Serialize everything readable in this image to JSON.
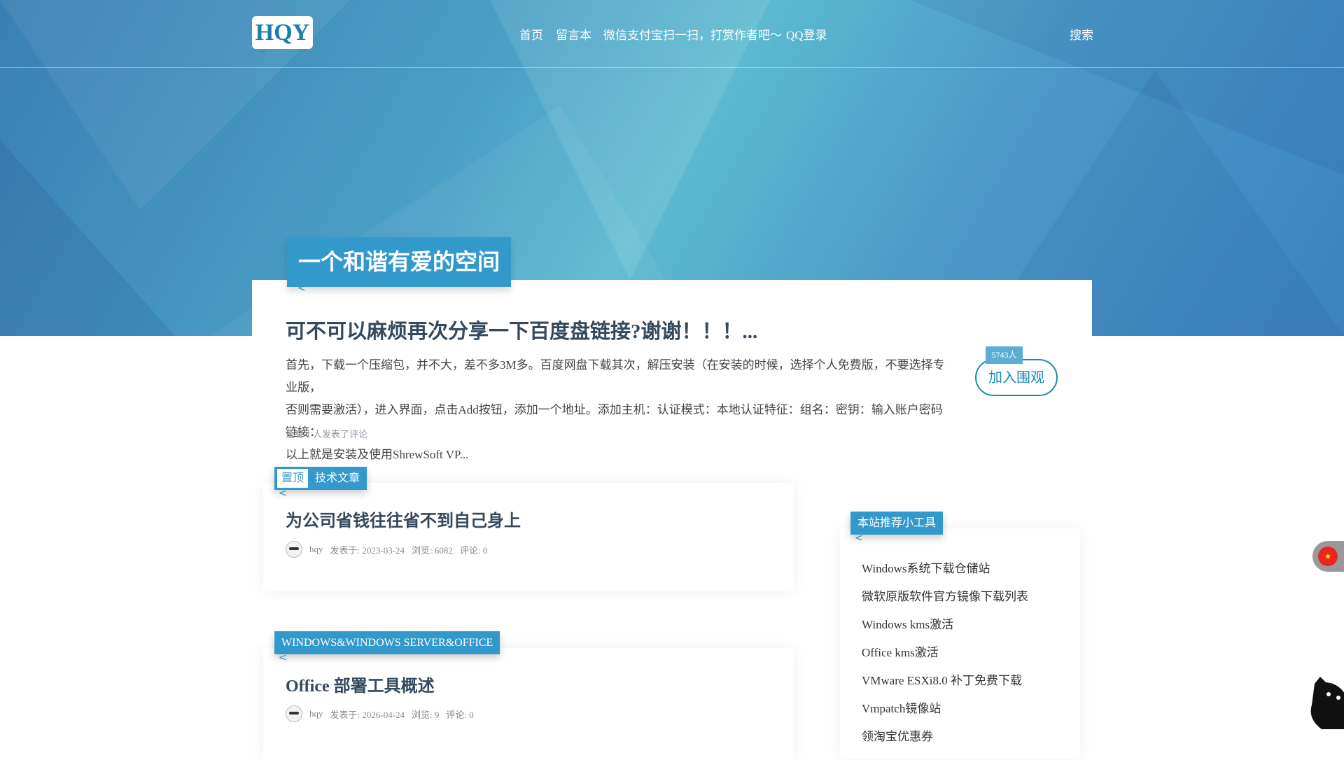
{
  "header": {
    "logo": "HQY",
    "nav": [
      "首页",
      "留言本",
      "微信支付宝扫一扫，打赏作者吧～",
      "QQ登录"
    ],
    "search": "搜索"
  },
  "banner": {
    "title": "一个和谐有爱的空间"
  },
  "featured": {
    "title": "可不可以麻烦再次分享一下百度盘链接?谢谢！！！...",
    "lines": [
      "首先，下载一个压缩包，并不大，差不多3M多。百度网盘下载其次，解压安装（在安装的时候，选择个人免费版，不要选择专业版，",
      "否则需要激活），进入界面，点击Add按钮，添加一个地址。添加主机：认证模式：本地认证特征：组名：密钥：输入账户密码链接：",
      "以上就是安装及使用ShrewSoft VP..."
    ],
    "comments": "还有 1 人发表了评论",
    "join_label": "加入围观",
    "join_count": "5743人"
  },
  "posts": [
    {
      "pinned": "置顶",
      "category": "技术文章",
      "title": "为公司省钱往往省不到自己身上",
      "author": "hqy",
      "date": "发表于: 2023-03-24",
      "views": "浏览: 6082",
      "comments": "评论: 0"
    },
    {
      "category": "WINDOWS&WINDOWS SERVER&OFFICE",
      "title": "Office 部署工具概述",
      "author": "hqy",
      "date": "发表于: 2026-04-24",
      "views": "浏览: 9",
      "comments": "评论: 0"
    }
  ],
  "sidebar": {
    "title": "本站推荐小工具",
    "items": [
      "Windows系统下载仓储站",
      "微软原版软件官方镜像下载列表",
      "Windows kms激活",
      "Office kms激活",
      "VMware ESXi8.0 补丁免费下载",
      "Vmpatch镜像站",
      "领淘宝优惠券"
    ]
  }
}
